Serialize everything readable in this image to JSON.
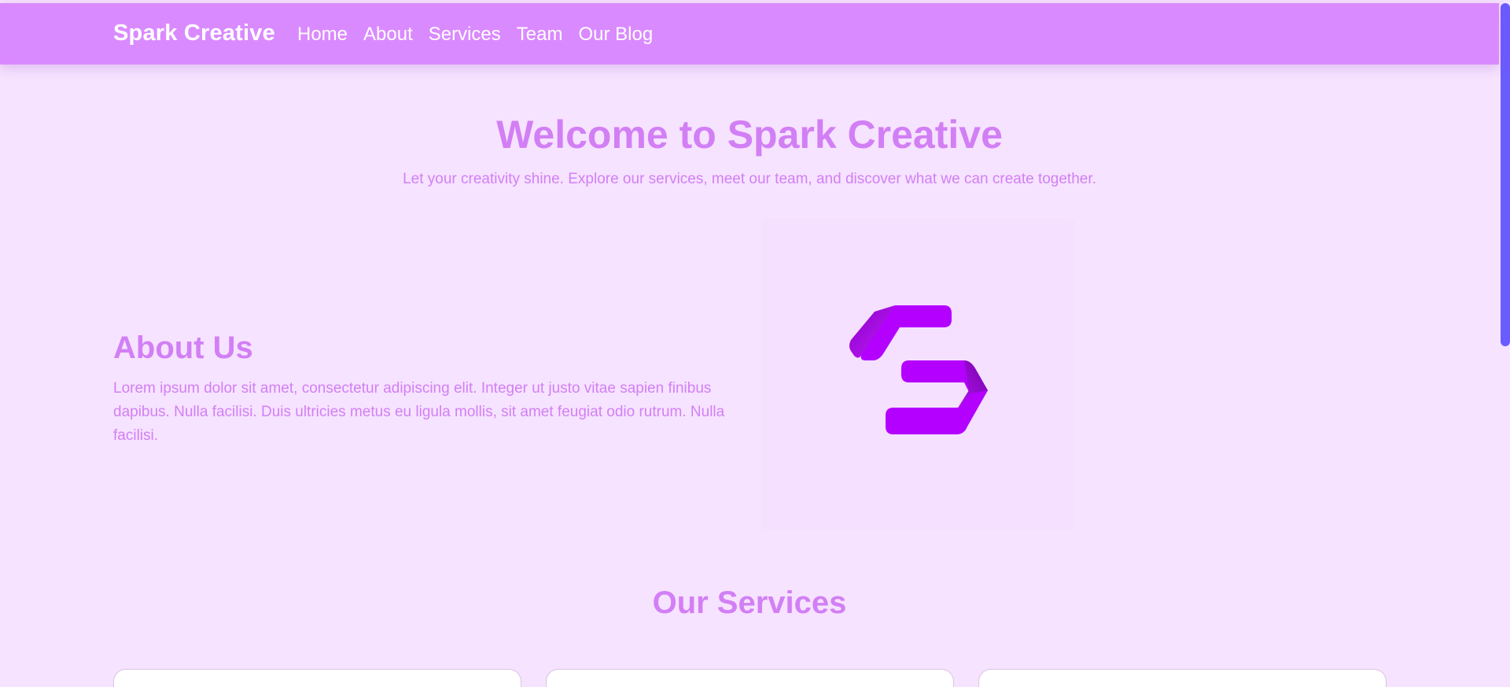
{
  "nav": {
    "brand": "Spark Creative",
    "links": [
      "Home",
      "About",
      "Services",
      "Team",
      "Our Blog"
    ]
  },
  "hero": {
    "title": "Welcome to Spark Creative",
    "subtitle": "Let your creativity shine. Explore our services, meet our team, and discover what we can create together."
  },
  "about": {
    "title": "About Us",
    "text": "Lorem ipsum dolor sit amet, consectetur adipiscing elit. Integer ut justo vitae sapien finibus dapibus. Nulla facilisi. Duis ultricies metus eu ligula mollis, sit amet feugiat odio rutrum. Nulla facilisi.",
    "logo_icon": "spark-s-logo-icon"
  },
  "services": {
    "title": "Our Services"
  },
  "colors": {
    "background": "#f6e3ff",
    "navbar": "#da8aff",
    "heading": "#d27ff5",
    "logo": "#b400ff",
    "scrollbar": "#6a5cff"
  }
}
